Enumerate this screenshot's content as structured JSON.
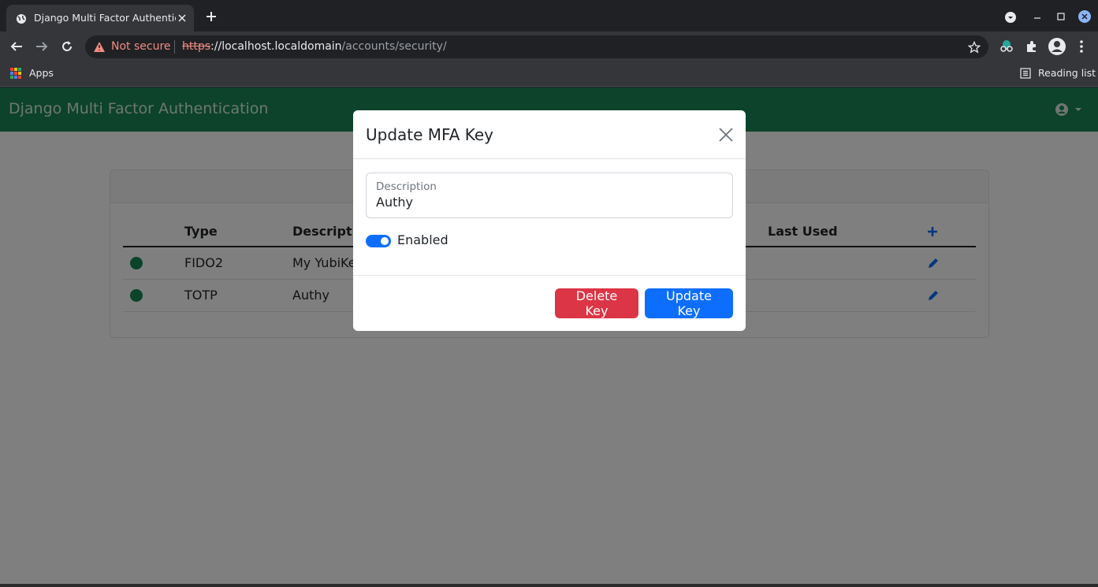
{
  "browser": {
    "tab_title": "Django Multi Factor Authenticati",
    "security_text": "Not secure",
    "url_scheme": "https",
    "url_host": "://localhost.localdomain",
    "url_path": "/accounts/security/",
    "bookmarks": {
      "apps_label": "Apps",
      "reading_list_label": "Reading list"
    }
  },
  "app": {
    "brand": "Django Multi Factor Authentication",
    "table": {
      "headers": [
        "Type",
        "Description",
        "Last Used"
      ],
      "rows": [
        {
          "type": "FIDO2",
          "description": "My YubiKey",
          "status": "enabled"
        },
        {
          "type": "TOTP",
          "description": "Authy",
          "status": "enabled"
        }
      ]
    }
  },
  "modal": {
    "title": "Update MFA Key",
    "description_label": "Description",
    "description_value": "Authy",
    "enabled_label": "Enabled",
    "enabled": true,
    "delete_label": "Delete Key",
    "update_label": "Update Key"
  },
  "colors": {
    "navbar": "#198754",
    "primary": "#0d6efd",
    "danger": "#dc3545",
    "status_dot": "#198754"
  }
}
